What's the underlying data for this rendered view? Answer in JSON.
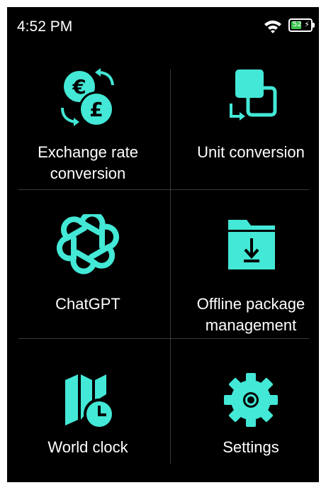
{
  "status_bar": {
    "time": "4:52 PM",
    "battery_level": "52",
    "battery_fill_fraction": 0.52,
    "battery_color": "#3cc44f",
    "charging_icon": "bolt-icon"
  },
  "accent_color": "#43e8d6",
  "menu": {
    "items": [
      {
        "id": "exchange",
        "icon": "currency-exchange-icon",
        "line1": "Exchange rate",
        "line2": "conversion"
      },
      {
        "id": "unit",
        "icon": "unit-conversion-icon",
        "line1": "Unit conversion",
        "line2": ""
      },
      {
        "id": "chatgpt",
        "icon": "chatgpt-icon",
        "line1": "ChatGPT",
        "line2": ""
      },
      {
        "id": "offline",
        "icon": "download-folder-icon",
        "line1": "Offline package",
        "line2": "management"
      },
      {
        "id": "worldclock",
        "icon": "world-clock-map-icon",
        "line1": "World clock",
        "line2": ""
      },
      {
        "id": "settings",
        "icon": "gear-icon",
        "line1": "Settings",
        "line2": ""
      }
    ]
  }
}
